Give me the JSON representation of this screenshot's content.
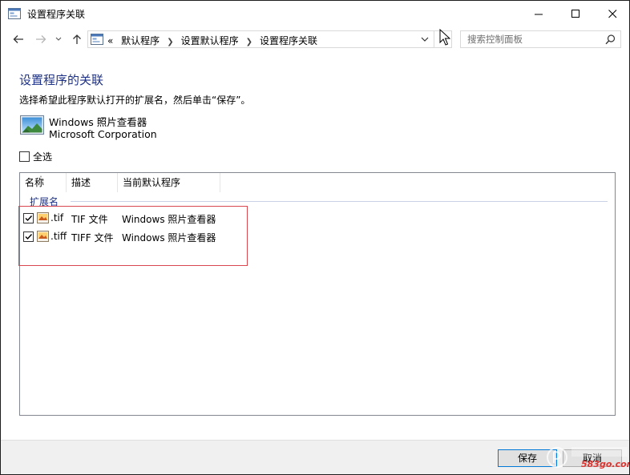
{
  "window": {
    "title": "设置程序关联"
  },
  "address": {
    "overflow": "«",
    "crumbs": [
      "默认程序",
      "设置默认程序",
      "设置程序关联"
    ]
  },
  "search": {
    "placeholder": "搜索控制面板"
  },
  "main": {
    "heading": "设置程序的关联",
    "description": "选择希望此程序默认打开的扩展名，然后单击“保存”。",
    "program": {
      "name": "Windows 照片查看器",
      "company": "Microsoft Corporation"
    },
    "select_all_label": "全选",
    "select_all_checked": false
  },
  "list": {
    "columns": [
      "名称",
      "描述",
      "当前默认程序"
    ],
    "group": "扩展名",
    "rows": [
      {
        "checked": true,
        "ext": ".tif",
        "desc": "TIF 文件",
        "program": "Windows 照片查看器"
      },
      {
        "checked": true,
        "ext": ".tiff",
        "desc": "TIFF 文件",
        "program": "Windows 照片查看器"
      }
    ]
  },
  "footer": {
    "save_label": "保存",
    "cancel_label": "取消"
  },
  "watermark": {
    "text": "583go.com"
  },
  "colors": {
    "heading": "#1e3287",
    "highlight": "#d9474f",
    "accent": "#0078d7"
  }
}
